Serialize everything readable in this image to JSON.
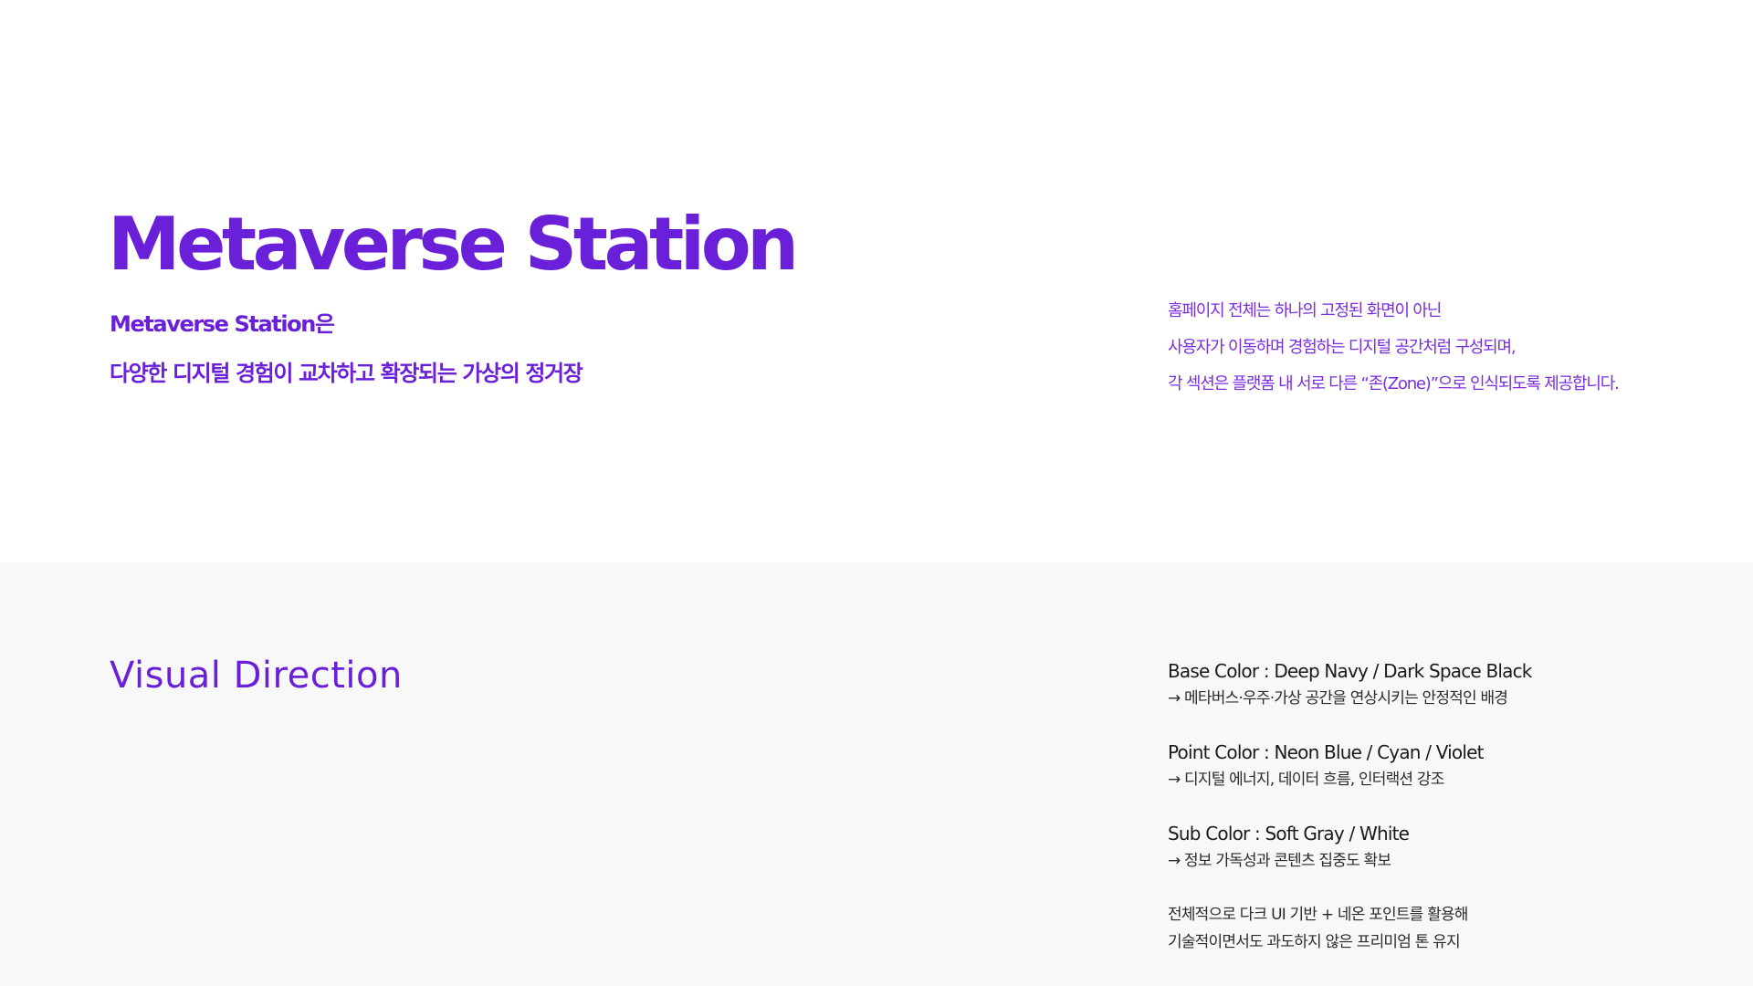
{
  "hero": {
    "title": "Metaverse Station",
    "subtitle_line1": "Metaverse Station은",
    "subtitle_line2": "다양한 디지털 경험이 교차하고 확장되는 가상의 정거장",
    "description": [
      "홈페이지 전체는 하나의 고정된 화면이 아닌",
      "사용자가 이동하며 경험하는 디지털 공간처럼 구성되며,",
      "각 섹션은 플랫폼 내 서로 다른 “존(Zone)”으로 인식되도록 제공합니다."
    ]
  },
  "visual_direction": {
    "title": "Visual Direction",
    "items": [
      {
        "heading": "Base Color : Deep Navy / Dark Space Black",
        "note": "→ 메타버스·우주·가상 공간을 연상시키는 안정적인 배경"
      },
      {
        "heading": "Point Color : Neon Blue / Cyan / Violet",
        "note": "→ 디지털 에너지, 데이터 흐름, 인터랙션 강조"
      },
      {
        "heading": "Sub Color : Soft Gray / White",
        "note": "→ 정보 가독성과 콘텐츠 집중도 확보"
      }
    ],
    "summary_line1": "전체적으로 다크 UI 기반 + 네온 포인트를 활용해",
    "summary_line2": "기술적이면서도 과도하지 않은 프리미엄 톤 유지"
  },
  "colors": {
    "accent": "#6a1fd8",
    "accent_light": "#7a2ee0",
    "section_background": "#f8f8f8",
    "text": "#1a1a1a"
  }
}
